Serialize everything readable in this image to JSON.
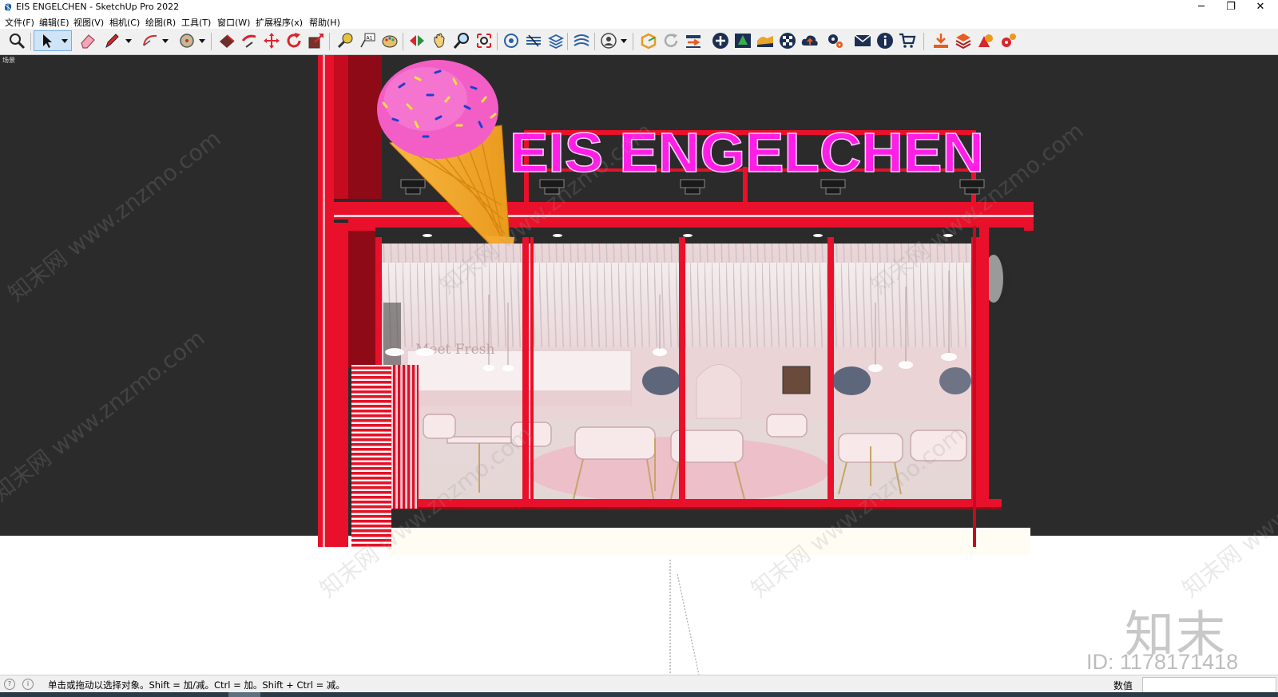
{
  "window": {
    "title": "EIS ENGELCHEN - SketchUp Pro 2022",
    "minimize_label": "─",
    "restore_label": "❐",
    "close_label": "✕"
  },
  "menu": {
    "items": [
      "文件(F)",
      "编辑(E)",
      "视图(V)",
      "相机(C)",
      "绘图(R)",
      "工具(T)",
      "窗口(W)",
      "扩展程序(x)",
      "帮助(H)"
    ]
  },
  "toolbar": {
    "active_tool": "select",
    "tools": [
      "zoom-extents",
      "select",
      "eraser",
      "line",
      "arc",
      "shape",
      "paint-bucket",
      "push-pull",
      "move",
      "rotate",
      "scale",
      "tape-measure",
      "text",
      "paint",
      "orbit",
      "pan",
      "zoom",
      "zoom-window",
      "component",
      "layers",
      "styles",
      "sandbox",
      "account",
      "3d-warehouse",
      "reload",
      "send",
      "add",
      "tree",
      "terrain",
      "checker",
      "cloud-upload",
      "settings",
      "mail",
      "info",
      "cart",
      "download",
      "export",
      "extension-a",
      "extension-b"
    ]
  },
  "scene": {
    "tab_label": "场景",
    "sign_text": "EIS ENGELCHEN",
    "interior_sign": "Meet Fresh",
    "colors": {
      "background": "#2b2b2b",
      "frame_red": "#e8102a",
      "dark_red": "#8e0a17",
      "sign_magenta": "#ff1ee6",
      "ground": "#fffdf3"
    }
  },
  "watermark": {
    "logo": "知末",
    "id": "ID: 1178171418",
    "repeat_text": "知末网 www.znzmo.com"
  },
  "status": {
    "hint": "单击或拖动以选择对象。Shift = 加/减。Ctrl = 加。Shift + Ctrl = 减。",
    "measurements_label": "数值",
    "measurements_value": ""
  }
}
